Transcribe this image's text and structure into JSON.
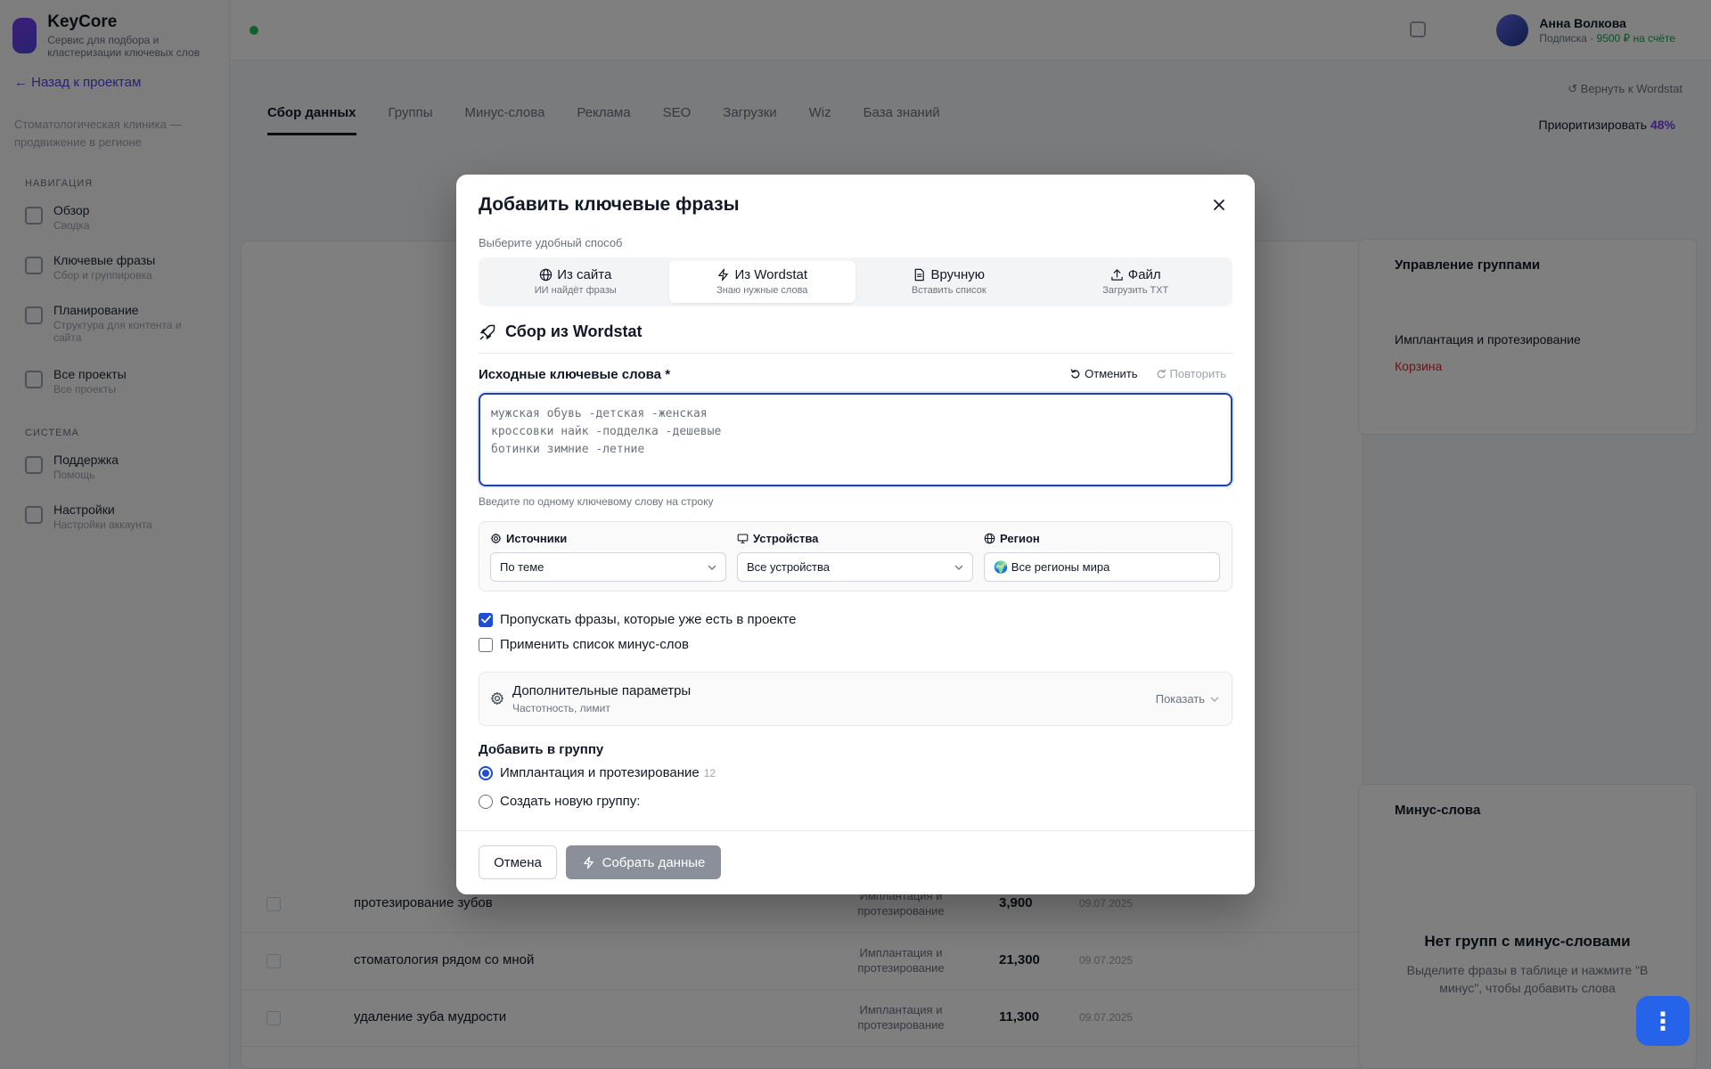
{
  "app": {
    "name": "KeyCore",
    "tagline": "Сервис для подбора и кластеризации ключевых слов",
    "back": "← Назад к проектам",
    "project": "Стоматологическая клиника — продвижение в регионе"
  },
  "sidebar": {
    "sections": [
      {
        "title": "Навигация",
        "items": [
          {
            "label": "Обзор",
            "sub": "Сводка"
          },
          {
            "label": "Ключевые фразы",
            "sub": "Сбор и группировка"
          },
          {
            "label": "Планирование",
            "sub": "Структура для контента и сайта"
          },
          {
            "label": "Все проекты",
            "sub": "Все проекты"
          }
        ]
      },
      {
        "title": "Система",
        "items": [
          {
            "label": "Поддержка",
            "sub": "Помощь"
          },
          {
            "label": "Настройки",
            "sub": "Настройки аккаунта"
          }
        ]
      }
    ]
  },
  "topbar": {
    "user_name": "Анна Волкова",
    "user_role": "Подписка",
    "balance": "9500 ₽ на счёте"
  },
  "toolbar": {
    "reset": "↺ Вернуть к Wordstat",
    "priority_label": "Приоритизировать",
    "priority_value": "48%"
  },
  "bg_tabs": [
    "Сбор данных",
    "Группы",
    "Минус-слова",
    "Реклама",
    "SEO",
    "Загрузки",
    "Wiz",
    "База знаний"
  ],
  "bg_table": {
    "rows": [
      {
        "phrase": "протезирование зубов",
        "group": "Имплантация и протезирование",
        "num": "3,900",
        "date": "09.07.2025"
      },
      {
        "phrase": "стоматология рядом со мной",
        "group": "Имплантация и протезирование",
        "num": "21,300",
        "date": "09.07.2025"
      },
      {
        "phrase": "удаление зуба мудрости",
        "group": "Имплантация и протезирование",
        "num": "11,300",
        "date": "09.07.2025"
      }
    ]
  },
  "bg_right": {
    "groups_title": "Управление группами",
    "group1": "Имплантация и протезирование",
    "group2": "Корзина",
    "minus_title": "Минус-слова",
    "empty_title": "Нет групп с минус-словами",
    "empty_sub": "Выделите фразы в таблице и нажмите \"В минус\", чтобы добавить слова"
  },
  "modal": {
    "title": "Добавить ключевые фразы",
    "subtitle": "Выберите удобный способ",
    "tabs": [
      {
        "label": "Из сайта",
        "sub": "ИИ найдёт фразы"
      },
      {
        "label": "Из Wordstat",
        "sub": "Знаю нужные слова"
      },
      {
        "label": "Вручную",
        "sub": "Вставить список"
      },
      {
        "label": "Файл",
        "sub": "Загрузить TXT"
      }
    ],
    "section_title": "Сбор из Wordstat",
    "keywords_label": "Исходные ключевые слова",
    "required_mark": "*",
    "undo": "Отменить",
    "redo": "Повторить",
    "keywords_placeholder": "мужская обувь -детская -женская\nкроссовки найк -подделка -дешевые\nботинки зимние -летние",
    "keywords_value": "",
    "keywords_hint": "Введите по одному ключевому слову на строку",
    "sources_label": "Источники",
    "sources_value": "По теме",
    "devices_label": "Устройства",
    "devices_value": "Все устройства",
    "region_label": "Регион",
    "region_value": "🌍 Все регионы мира",
    "skip_existing": "Пропускать фразы, которые уже есть в проекте",
    "skip_existing_checked": true,
    "apply_minus": "Применить список минус-слов",
    "apply_minus_checked": false,
    "advanced_title": "Дополнительные параметры",
    "advanced_sub": "Частотность, лимит",
    "advanced_toggle": "Показать",
    "group_label": "Добавить в группу",
    "group_existing": "Имплантация и протезирование",
    "group_existing_count": "12",
    "group_new": "Создать новую группу:",
    "cancel": "Отмена",
    "collect": "Собрать данные"
  }
}
